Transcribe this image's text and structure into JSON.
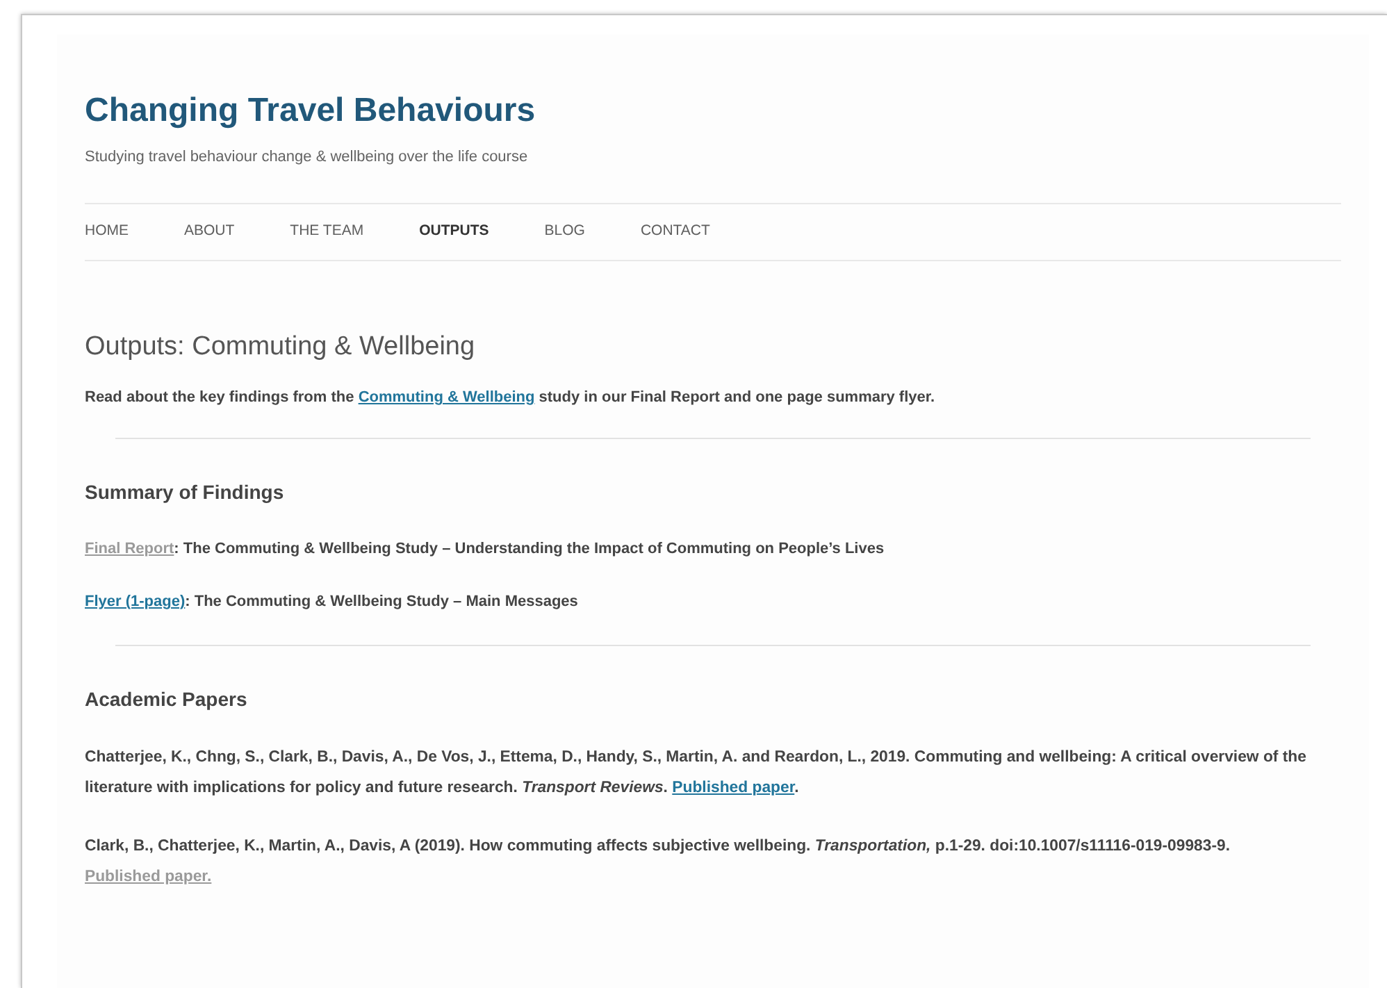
{
  "site": {
    "title": "Changing Travel Behaviours",
    "tagline": "Studying travel behaviour change & wellbeing over the life course"
  },
  "nav": [
    {
      "label": "HOME",
      "selected": false
    },
    {
      "label": "ABOUT",
      "selected": false
    },
    {
      "label": "THE TEAM",
      "selected": false
    },
    {
      "label": "OUTPUTS",
      "selected": true
    },
    {
      "label": "BLOG",
      "selected": false
    },
    {
      "label": "CONTACT",
      "selected": false
    }
  ],
  "page": {
    "title": "Outputs: Commuting & Wellbeing",
    "intro": {
      "before": "Read about the key findings from the",
      "link": {
        "text": "Commuting & Wellbeing",
        "visited": false
      },
      "after": "study in our Final Report and one page summary flyer."
    }
  },
  "summary": {
    "heading": "Summary of Findings",
    "items": [
      {
        "link": {
          "text": "Final Report",
          "visited": true
        },
        "text": ": The Commuting & Wellbeing Study – Understanding the Impact of Commuting on People’s Lives"
      },
      {
        "link": {
          "text": "Flyer (1-page)",
          "visited": false
        },
        "text": ": The Commuting & Wellbeing Study – Main Messages"
      }
    ]
  },
  "papers": {
    "heading": "Academic Papers",
    "items": [
      {
        "text": "Chatterjee, K., Chng, S., Clark, B., Davis, A., De Vos, J., Ettema, D., Handy, S., Martin, A. and Reardon, L., 2019. Commuting and wellbeing: A critical overview of the literature with implications for policy and future research. *Transport Reviews*.",
        "link": {
          "text": "Published paper",
          "visited": false
        },
        "after": "."
      },
      {
        "text": "Clark, B., Chatterjee, K., Martin, A., Davis, A  (2019). How commuting affects subjective wellbeing. *Transportation,* p.1-29. doi:10.1007/s11116-019-09983-9.",
        "link": {
          "text": "Published paper.",
          "visited": true
        }
      }
    ]
  }
}
